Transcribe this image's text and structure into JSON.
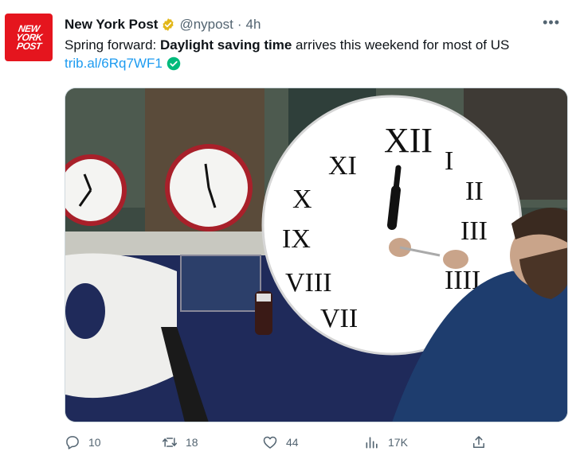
{
  "avatar": {
    "lines": [
      "NEW",
      "YORK",
      "POST"
    ]
  },
  "author": {
    "name": "New York Post",
    "handle": "@nypost",
    "separator": "·",
    "time": "4h"
  },
  "tweet": {
    "text_before": "Spring forward: ",
    "text_bold": "Daylight saving time",
    "text_after": " arrives this weekend for most of US",
    "link": "trib.al/6Rq7WF1"
  },
  "actions": {
    "replies": "10",
    "retweets": "18",
    "likes": "44",
    "views": "17K"
  },
  "colors": {
    "link": "#1d9bf0",
    "muted": "#536471",
    "verified_gold": "#e2b719",
    "check_green": "#00ba7c",
    "brand_red": "#e5151e"
  },
  "icons": [
    "verified-badge-icon",
    "more-icon",
    "link-check-icon",
    "reply-icon",
    "retweet-icon",
    "like-icon",
    "views-icon",
    "share-icon"
  ]
}
